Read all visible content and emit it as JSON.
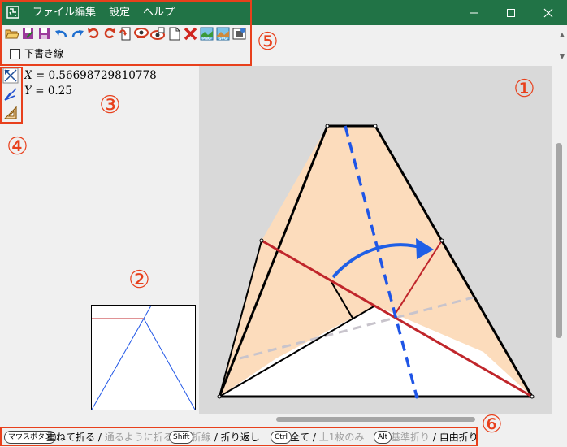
{
  "menu": {
    "file": "ファイル",
    "edit": "編集",
    "settings": "設定",
    "help": "ヘルプ"
  },
  "toolbar": {
    "draft_lines_label": "下書き線",
    "icons": [
      "open-icon",
      "save-as-icon",
      "save-icon",
      "undo-icon",
      "redo-icon",
      "rotate-ccw-icon",
      "rotate-cw-icon",
      "flip-icon",
      "view-back-icon",
      "view-reverse-icon",
      "new-page-icon",
      "delete-icon",
      "export-png-icon",
      "export-svg-icon",
      "export-image-icon"
    ]
  },
  "coords": {
    "x_var": "X",
    "x_value": "= 0.56698729810778",
    "y_var": "Y",
    "y_value": "= 0.25"
  },
  "status": {
    "mouse_key": "マウスボタン",
    "mouse_action": "重ねて折る / ",
    "mouse_alt": "通るように折る",
    "shift_key": "Shift",
    "shift_action_gray": "折線",
    "shift_action": " / 折り返し",
    "ctrl_key": "Ctrl",
    "ctrl_action": "全て / ",
    "ctrl_alt": "上1枚のみ",
    "alt_key": "Alt",
    "alt_action_gray": "基準折り",
    "alt_action": " / 自由折り"
  },
  "annotations": {
    "n1": "①",
    "n2": "②",
    "n3": "③",
    "n4": "④",
    "n5": "⑤",
    "n6": "⑥"
  },
  "colors": {
    "title_bar": "#217346",
    "paper": "#fcdcbc",
    "crease_valley": "#1f55e6",
    "crease_mountain": "#c0262b",
    "annotation_red": "#e8401c"
  }
}
